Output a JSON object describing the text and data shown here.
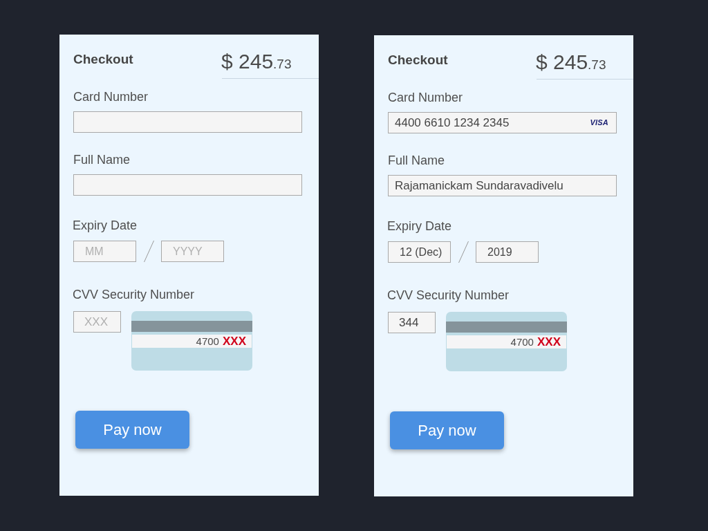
{
  "panels": [
    {
      "title": "Checkout",
      "amount": "$ 245",
      "amount_cents": ".73",
      "fields": [
        {
          "kind": "card",
          "label": "Card Number"
        },
        {
          "kind": "name",
          "label": "Full Name"
        },
        {
          "kind": "expiry",
          "label": "Expiry Date",
          "inputs": [
            {
              "placeholder": "MM"
            },
            {
              "placeholder": "YYYY"
            }
          ]
        },
        {
          "kind": "cvv",
          "label": "CVV Security Number",
          "placeholder": "XXX",
          "card_digits": "4700",
          "card_code": "XXX"
        }
      ],
      "button": "Pay now"
    },
    {
      "title": "Checkout",
      "amount": "$ 245",
      "amount_cents": ".73",
      "fields": [
        {
          "kind": "card",
          "label": "Card Number",
          "value": "4400 6610 1234 2345",
          "brand": "VISA"
        },
        {
          "kind": "name",
          "label": "Full Name",
          "value": "Rajamanickam Sundaravadivelu"
        },
        {
          "kind": "expiry",
          "label": "Expiry Date",
          "inputs": [
            {
              "value": "12 (Dec)"
            },
            {
              "value": "2019"
            }
          ]
        },
        {
          "kind": "cvv",
          "label": "CVV Security Number",
          "value": "344",
          "card_digits": "4700",
          "card_code": "XXX"
        }
      ],
      "button": "Pay now"
    }
  ]
}
